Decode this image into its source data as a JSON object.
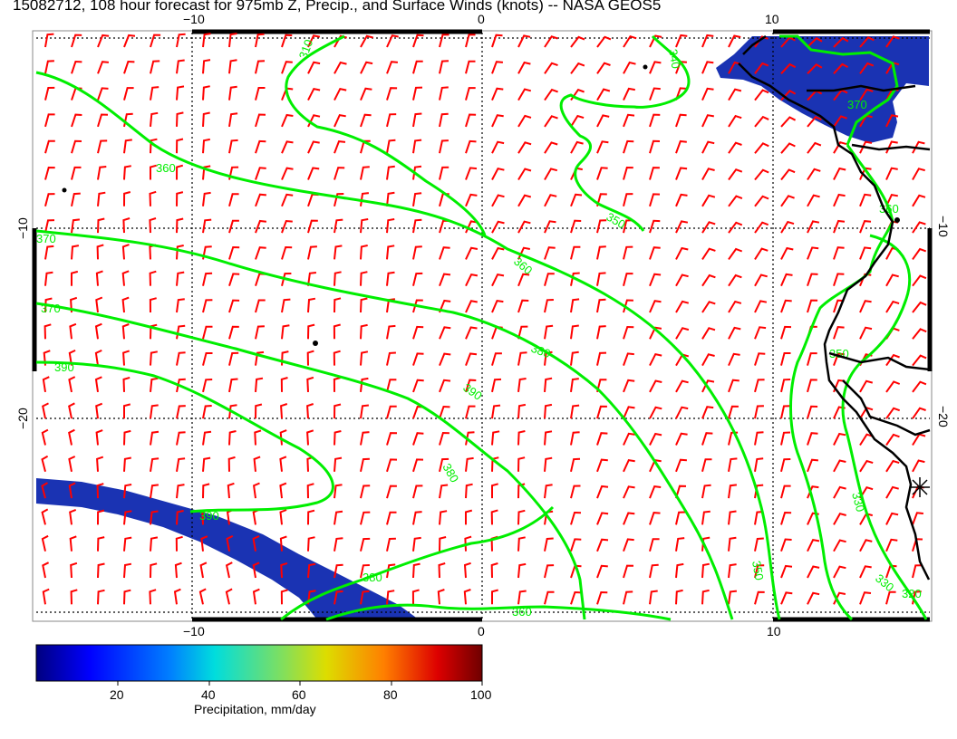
{
  "title": "15082712, 108 hour forecast for 975mb Z, Precip., and Surface Winds (knots) -- NASA GEOS5",
  "axes": {
    "top_labels": [
      "−10",
      "0",
      "10"
    ],
    "bottom_labels": [
      "−10",
      "0",
      "10"
    ],
    "left_labels": [
      "−10",
      "−20"
    ],
    "right_labels": [
      "−10",
      "−20"
    ]
  },
  "contours": {
    "color": "#00ee00",
    "labels": [
      "310",
      "340",
      "360",
      "350",
      "370",
      "360",
      "370",
      "380",
      "390",
      "390",
      "380",
      "390",
      "380",
      "360",
      "370",
      "360",
      "350",
      "350",
      "330",
      "330",
      "320"
    ]
  },
  "colorbar": {
    "title": "Precipitation, mm/day",
    "ticks": [
      "20",
      "40",
      "60",
      "80",
      "100"
    ],
    "colors": [
      "#00007f",
      "#0000ff",
      "#007fff",
      "#00ffff",
      "#7fff7f",
      "#ffff00",
      "#ff7f00",
      "#ff0000",
      "#7f0000"
    ]
  },
  "colors": {
    "wind_barbs": "#ff0000",
    "precip": "#1a33b3",
    "coastline": "#000000",
    "gridlines": "#000000"
  }
}
